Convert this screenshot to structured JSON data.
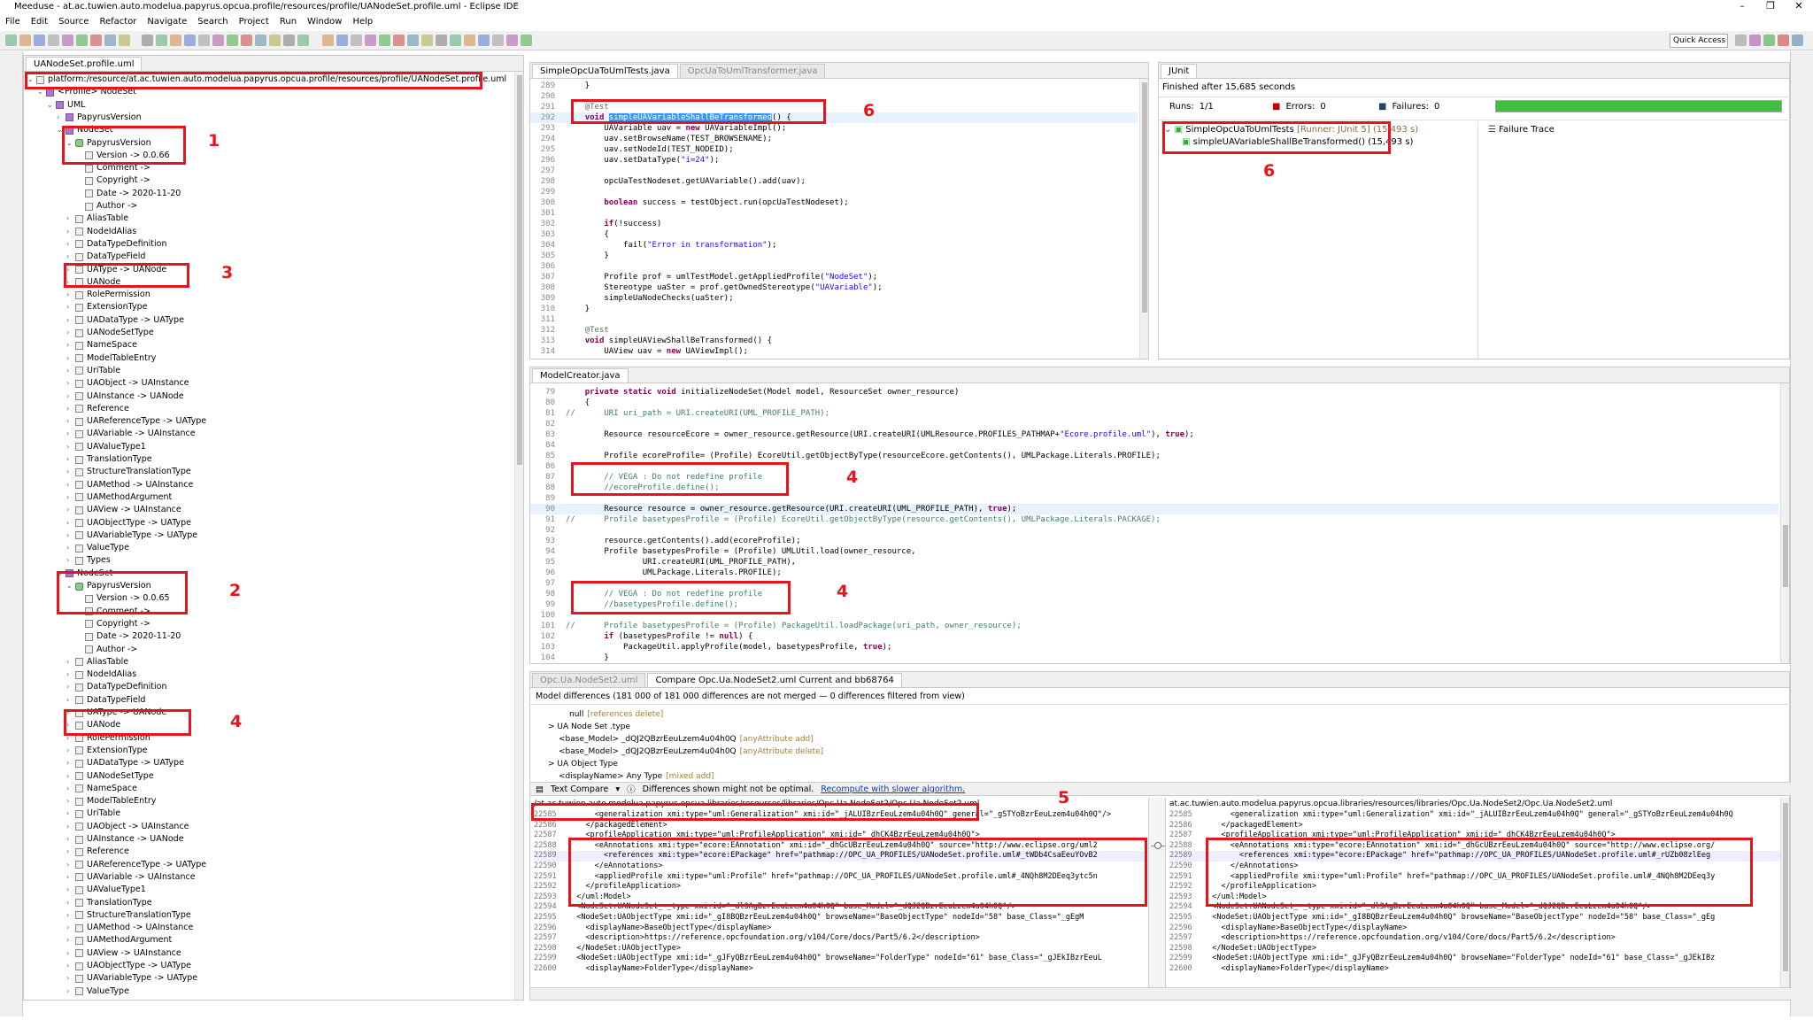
{
  "window": {
    "title": "Meeduse - at.ac.tuwien.auto.modelua.papyrus.opcua.profile/resources/profile/UANodeSet.profile.uml - Eclipse IDE"
  },
  "menu": [
    "File",
    "Edit",
    "Source",
    "Refactor",
    "Navigate",
    "Search",
    "Project",
    "Run",
    "Window",
    "Help"
  ],
  "toolbar": {
    "quick_access": "Quick Access"
  },
  "left": {
    "tab": "UANodeSet.profile.uml",
    "path": "platform:/resource/at.ac.tuwien.auto.modelua.papyrus.opcua.profile/resources/profile/UANodeSet.profile.uml",
    "top_rows": [
      {
        "d": 1,
        "a": "v",
        "t": "<Profile> NodeSet"
      },
      {
        "d": 2,
        "a": "v",
        "t": "UML"
      },
      {
        "d": 3,
        "a": ">",
        "t": "PapyrusVersion"
      },
      {
        "d": 3,
        "a": "v",
        "t": "NodeSet"
      },
      {
        "d": 4,
        "a": "v",
        "t": "PapyrusVersion"
      },
      {
        "d": 5,
        "a": "",
        "t": "Version -> 0.0.66"
      },
      {
        "d": 5,
        "a": "",
        "t": "Comment ->"
      },
      {
        "d": 5,
        "a": "",
        "t": "Copyright ->"
      },
      {
        "d": 5,
        "a": "",
        "t": "Date -> 2020-11-20"
      },
      {
        "d": 5,
        "a": "",
        "t": "Author ->"
      }
    ],
    "top_items": [
      "AliasTable",
      "NodeIdAlias",
      "DataTypeDefinition",
      "DataTypeField",
      "UAType -> UANode",
      "UANode",
      "RolePermission",
      "ExtensionType",
      "UADataType -> UAType",
      "UANodeSetType",
      "NameSpace",
      "ModelTableEntry",
      "UriTable",
      "UAObject -> UAInstance",
      "UAInstance -> UANode",
      "Reference",
      "UAReferenceType -> UAType",
      "UAVariable -> UAInstance",
      "UAValueType1",
      "TranslationType",
      "StructureTranslationType",
      "UAMethod -> UAInstance",
      "UAMethodArgument",
      "UAView -> UAInstance",
      "UAObjectType -> UAType",
      "UAVariableType -> UAType",
      "ValueType",
      "Types"
    ],
    "bottom_rows": [
      {
        "d": 3,
        "a": "v",
        "t": "NodeSet"
      },
      {
        "d": 4,
        "a": "v",
        "t": "PapyrusVersion"
      },
      {
        "d": 5,
        "a": "",
        "t": "Version -> 0.0.65"
      },
      {
        "d": 5,
        "a": "",
        "t": "Comment ->"
      },
      {
        "d": 5,
        "a": "",
        "t": "Copyright ->"
      },
      {
        "d": 5,
        "a": "",
        "t": "Date -> 2020-11-20"
      },
      {
        "d": 5,
        "a": "",
        "t": "Author ->"
      }
    ],
    "bottom_items": [
      "AliasTable",
      "NodeIdAlias",
      "DataTypeDefinition",
      "DataTypeField",
      "UAType -> UANode",
      "UANode",
      "RolePermission",
      "ExtensionType",
      "UADataType -> UAType",
      "UANodeSetType",
      "NameSpace",
      "ModelTableEntry",
      "UriTable",
      "UAObject -> UAInstance",
      "UAInstance -> UANode",
      "Reference",
      "UAReferenceType -> UAType",
      "UAVariable -> UAInstance",
      "UAValueType1",
      "TranslationType",
      "StructureTranslationType",
      "UAMethod -> UAInstance",
      "UAMethodArgument",
      "UAView -> UAInstance",
      "UAObjectType -> UAType",
      "UAVariableType -> UAType",
      "ValueType"
    ]
  },
  "editor1": {
    "tabs": [
      "SimpleOpcUaToUmlTests.java",
      "OpcUaToUmlTransformer.java"
    ],
    "lines": [
      {
        "n": "289",
        "c": "    }"
      },
      {
        "n": "290",
        "c": ""
      },
      {
        "n": "291",
        "c": "    @Test"
      },
      {
        "n": "292",
        "c": "    void simpleUAVariableShallBeTransformed() {"
      },
      {
        "n": "293",
        "c": "        UAVariable uav = new UAVariableImpl();"
      },
      {
        "n": "294",
        "c": "        uav.setBrowseName(TEST_BROWSENAME);"
      },
      {
        "n": "295",
        "c": "        uav.setNodeId(TEST_NODEID);"
      },
      {
        "n": "296",
        "c": "        uav.setDataType(\"i=24\");"
      },
      {
        "n": "297",
        "c": ""
      },
      {
        "n": "298",
        "c": "        opcUaTestNodeset.getUAVariable().add(uav);"
      },
      {
        "n": "299",
        "c": ""
      },
      {
        "n": "300",
        "c": "        boolean success = testObject.run(opcUaTestNodeset);"
      },
      {
        "n": "301",
        "c": ""
      },
      {
        "n": "302",
        "c": "        if(!success)"
      },
      {
        "n": "303",
        "c": "        {"
      },
      {
        "n": "304",
        "c": "            fail(\"Error in transformation\");"
      },
      {
        "n": "305",
        "c": "        }"
      },
      {
        "n": "306",
        "c": ""
      },
      {
        "n": "307",
        "c": "        Profile prof = umlTestModel.getAppliedProfile(\"NodeSet\");"
      },
      {
        "n": "308",
        "c": "        Stereotype uaSter = prof.getOwnedStereotype(\"UAVariable\");"
      },
      {
        "n": "309",
        "c": "        simpleUaNodeChecks(uaSter);"
      },
      {
        "n": "310",
        "c": "    }"
      },
      {
        "n": "311",
        "c": ""
      },
      {
        "n": "312",
        "c": "    @Test"
      },
      {
        "n": "313",
        "c": "    void simpleUAViewShallBeTransformed() {"
      },
      {
        "n": "314",
        "c": "        UAView uav = new UAViewImpl();"
      }
    ]
  },
  "junit": {
    "tab": "JUnit",
    "finished": "Finished after 15,685 seconds",
    "runs_label": "Runs:",
    "runs": "1/1",
    "errors_label": "Errors:",
    "errors": "0",
    "failures_label": "Failures:",
    "failures": "0",
    "progress": 1.0,
    "suite": "SimpleOpcUaToUmlTests",
    "suite_meta": "[Runner: JUnit 5] (15,493 s)",
    "test": "simpleUAVariableShallBeTransformed() (15,493 s)",
    "failure_trace": "Failure Trace",
    "color_ok": "#3fbf3f"
  },
  "editor2": {
    "tab": "ModelCreator.java",
    "lines": [
      {
        "n": "79",
        "c": "    private static void initializeNodeSet(Model model, ResourceSet owner_resource)"
      },
      {
        "n": "80",
        "c": "    {"
      },
      {
        "n": "81",
        "c": "//      URI uri_path = URI.createURI(UML_PROFILE_PATH);"
      },
      {
        "n": "82",
        "c": ""
      },
      {
        "n": "83",
        "c": "        Resource resourceEcore = owner_resource.getResource(URI.createURI(UMLResource.PROFILES_PATHMAP+\"Ecore.profile.uml\"), true);"
      },
      {
        "n": "84",
        "c": ""
      },
      {
        "n": "85",
        "c": "        Profile ecoreProfile= (Profile) EcoreUtil.getObjectByType(resourceEcore.getContents(), UMLPackage.Literals.PROFILE);"
      },
      {
        "n": "86",
        "c": ""
      },
      {
        "n": "87",
        "c": "        // VEGA : Do not redefine profile"
      },
      {
        "n": "88",
        "c": "        //ecoreProfile.define();"
      },
      {
        "n": "89",
        "c": ""
      },
      {
        "n": "90",
        "c": "        Resource resource = owner_resource.getResource(URI.createURI(UML_PROFILE_PATH), true);"
      },
      {
        "n": "91",
        "c": "//      Profile basetypesProfile = (Profile) EcoreUtil.getObjectByType(resource.getContents(), UMLPackage.Literals.PACKAGE);"
      },
      {
        "n": "92",
        "c": ""
      },
      {
        "n": "93",
        "c": "        resource.getContents().add(ecoreProfile);"
      },
      {
        "n": "94",
        "c": "        Profile basetypesProfile = (Profile) UMLUtil.load(owner_resource,"
      },
      {
        "n": "95",
        "c": "                URI.createURI(UML_PROFILE_PATH),"
      },
      {
        "n": "96",
        "c": "                UMLPackage.Literals.PROFILE);"
      },
      {
        "n": "97",
        "c": ""
      },
      {
        "n": "98",
        "c": "        // VEGA : Do not redefine profile"
      },
      {
        "n": "99",
        "c": "        //basetypesProfile.define();"
      },
      {
        "n": "100",
        "c": ""
      },
      {
        "n": "101",
        "c": "//      Profile basetypesProfile = (Profile) PackageUtil.loadPackage(uri_path, owner_resource);"
      },
      {
        "n": "102",
        "c": "        if (basetypesProfile != null) {"
      },
      {
        "n": "103",
        "c": "            PackageUtil.applyProfile(model, basetypesProfile, true);"
      },
      {
        "n": "104",
        "c": "        }"
      }
    ]
  },
  "compare": {
    "tabs": [
      "Opc.Ua.NodeSet2.uml",
      "Compare Opc.Ua.NodeSet2.uml Current and bb68764"
    ],
    "summary": "Model differences  (181 000 of 181 000 differences are not merged — 0 differences filtered from view)",
    "tree": [
      {
        "d": 3,
        "t": "null",
        "g": "[references delete]"
      },
      {
        "d": 1,
        "t": "> UA Node Set .type",
        "g": ""
      },
      {
        "d": 2,
        "t": "<base_Model> _dQJ2QBzrEeuLzem4u04h0Q",
        "g": "[anyAttribute add]"
      },
      {
        "d": 2,
        "t": "<base_Model> _dQJ2QBzrEeuLzem4u04h0Q",
        "g": "[anyAttribute delete]"
      },
      {
        "d": 1,
        "t": "> UA Object Type",
        "g": ""
      },
      {
        "d": 2,
        "t": "<displayName> Any Type",
        "g": "[mixed add]"
      }
    ],
    "text_compare": "Text Compare",
    "notice": "Differences shown might not be optimal.",
    "recompute": "Recompute with slower algorithm.",
    "left_path": "/at.ac.tuwien.auto.modelua.papyrus.opcua.libraries/resources/libraries/Opc.Ua.NodeSet2/Opc.Ua.NodeSet2.uml",
    "right_path": "at.ac.tuwien.auto.modelua.papyrus.opcua.libraries/resources/libraries/Opc.Ua.NodeSet2/Opc.Ua.NodeSet2.uml",
    "left_lines": [
      {
        "n": "22585",
        "c": "      <generalization xmi:type=\"uml:Generalization\" xmi:id=\"_jALUIBzrEeuLzem4u04h0Q\" general=\"_gSTYoBzrEeuLzem4u04h0Q\"/>"
      },
      {
        "n": "22586",
        "c": "    </packagedElement>"
      },
      {
        "n": "22587",
        "c": "    <profileApplication xmi:type=\"uml:ProfileApplication\" xmi:id=\"_dhCK4BzrEeuLzem4u04h0Q\">"
      },
      {
        "n": "22588",
        "c": "      <eAnnotations xmi:type=\"ecore:EAnnotation\" xmi:id=\"_dhGcUBzrEeuLzem4u04h0Q\" source=\"http://www.eclipse.org/uml2"
      },
      {
        "n": "22589",
        "c": "        <references xmi:type=\"ecore:EPackage\" href=\"pathmap://OPC_UA_PROFILES/UANodeSet.profile.uml#_tWDb4CsaEeuYOvB2"
      },
      {
        "n": "22590",
        "c": "      </eAnnotations>"
      },
      {
        "n": "22591",
        "c": "      <appliedProfile xmi:type=\"uml:Profile\" href=\"pathmap://OPC_UA_PROFILES/UANodeSet.profile.uml#_4NQh8M2DEeq3ytc5n"
      },
      {
        "n": "22592",
        "c": "    </profileApplication>"
      },
      {
        "n": "22593",
        "c": "  </uml:Model>"
      },
      {
        "n": "22594",
        "c": "  <NodeSet:UANodeSet_-_type xmi:id=\"_dl3AgBzrEeuLzem4u04h0Q\" base_Model=\"_dQJ2QBzrEeuLzem4u04h0Q\"/>"
      },
      {
        "n": "22595",
        "c": "  <NodeSet:UAObjectType xmi:id=\"_gI8BQBzrEeuLzem4u04h0Q\" browseName=\"BaseObjectType\" nodeId=\"58\" base_Class=\"_gEgM"
      },
      {
        "n": "22596",
        "c": "    <displayName>BaseObjectType</displayName>"
      },
      {
        "n": "22597",
        "c": "    <description>https://reference.opcfoundation.org/v104/Core/docs/Part5/6.2</description>"
      },
      {
        "n": "22598",
        "c": "  </NodeSet:UAObjectType>"
      },
      {
        "n": "22599",
        "c": "  <NodeSet:UAObjectType xmi:id=\"_gJFyQBzrEeuLzem4u04h0Q\" browseName=\"FolderType\" nodeId=\"61\" base_Class=\"_gJEkIBzrEeuL"
      },
      {
        "n": "22600",
        "c": "    <displayName>FolderType</displayName>"
      }
    ],
    "right_lines": [
      {
        "n": "22585",
        "c": "      <generalization xmi:type=\"uml:Generalization\" xmi:id=\"_jALUIBzrEeuLzem4u04h0Q\" general=\"_gSTYoBzrEeuLzem4u04h0Q"
      },
      {
        "n": "22586",
        "c": "    </packagedElement>"
      },
      {
        "n": "22587",
        "c": "    <profileApplication xmi:type=\"uml:ProfileApplication\" xmi:id=\"_dhCK4BzrEeuLzem4u04h0Q\">"
      },
      {
        "n": "22588",
        "c": "      <eAnnotations xmi:type=\"ecore:EAnnotation\" xmi:id=\"_dhGcUBzrEeuLzem4u04h0Q\" source=\"http://www.eclipse.org/"
      },
      {
        "n": "22589",
        "c": "        <references xmi:type=\"ecore:EPackage\" href=\"pathmap://OPC_UA_PROFILES/UANodeSet.profile.uml#_rUZb08zlEeg"
      },
      {
        "n": "22590",
        "c": "      </eAnnotations>"
      },
      {
        "n": "22591",
        "c": "      <appliedProfile xmi:type=\"uml:Profile\" href=\"pathmap://OPC_UA_PROFILES/UANodeSet.profile.uml#_4NQh8M2DEeq3y"
      },
      {
        "n": "22592",
        "c": "    </profileApplication>"
      },
      {
        "n": "22593",
        "c": "  </uml:Model>"
      },
      {
        "n": "22594",
        "c": "  <NodeSet:UANodeSet_-_type xmi:id=\"_dl3AgBzrEeuLzem4u04h0Q\" base_Model=\"_dQJ2QBzrEeuLzem4u04h0Q\"/>"
      },
      {
        "n": "22595",
        "c": "  <NodeSet:UAObjectType xmi:id=\"_gI8BQBzrEeuLzem4u04h0Q\" browseName=\"BaseObjectType\" nodeId=\"58\" base_Class=\"_gEg"
      },
      {
        "n": "22596",
        "c": "    <displayName>BaseObjectType</displayName>"
      },
      {
        "n": "22597",
        "c": "    <description>https://reference.opcfoundation.org/v104/Core/docs/Part5/6.2</description>"
      },
      {
        "n": "22598",
        "c": "  </NodeSet:UAObjectType>"
      },
      {
        "n": "22599",
        "c": "  <NodeSet:UAObjectType xmi:id=\"_gJFyQBzrEeuLzem4u04h0Q\" browseName=\"FolderType\" nodeId=\"61\" base_Class=\"_gJEkIBz"
      },
      {
        "n": "22600",
        "c": "    <displayName>FolderType</displayName>"
      }
    ]
  },
  "annotations": {
    "n1": "1",
    "n2": "2",
    "n3": "3",
    "n4a": "4",
    "n4b": "4",
    "n4c": "4",
    "n5": "5",
    "n6a": "6",
    "n6b": "6"
  },
  "colors": {
    "annotation": "#e8141c",
    "keyword": "#7f0055",
    "string": "#2a00ff",
    "comment": "#3f7f5f"
  }
}
